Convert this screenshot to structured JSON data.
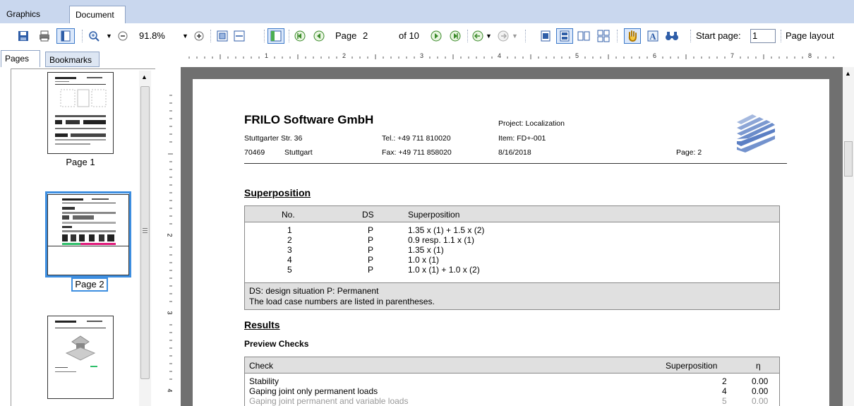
{
  "tabs": {
    "graphics": "Graphics",
    "document": "Document"
  },
  "toolbar": {
    "zoom": "91.8%",
    "page_label": "Page",
    "page_value": "2",
    "of_label": "of 10",
    "start_page_label": "Start page:",
    "start_page_value": "1",
    "page_layout_label": "Page layout"
  },
  "left_panel": {
    "tabs": {
      "pages": "Pages",
      "bookmarks": "Bookmarks"
    },
    "thumbs": [
      {
        "label": "Page 1"
      },
      {
        "label": "Page 2"
      }
    ]
  },
  "ruler": {
    "marks": [
      "1",
      "2",
      "3",
      "4",
      "5",
      "6",
      "7",
      "8"
    ],
    "vmarks": [
      "2",
      "3",
      "4"
    ]
  },
  "document": {
    "company": "FRILO Software GmbH",
    "street": "Stuttgarter Str. 36",
    "zip": "70469",
    "city": "Stuttgart",
    "tel": "Tel.: +49 711 810020",
    "fax": "Fax: +49 711 858020",
    "project": "Project: Localization",
    "item": "Item: FD+-001",
    "date": "8/16/2018",
    "page": "Page: 2",
    "superposition_title": "Superposition",
    "sp_headers": {
      "no": "No.",
      "ds": "DS",
      "sp": "Superposition"
    },
    "sp_rows": [
      {
        "no": "1",
        "ds": "P",
        "sp": "1.35 x (1) + 1.5 x (2)"
      },
      {
        "no": "2",
        "ds": "P",
        "sp": "0.9 resp. 1.1 x (1)"
      },
      {
        "no": "3",
        "ds": "P",
        "sp": "1.35 x (1)"
      },
      {
        "no": "4",
        "ds": "P",
        "sp": "1.0 x (1)"
      },
      {
        "no": "5",
        "ds": "P",
        "sp": "1.0 x (1) + 1.0 x (2)"
      }
    ],
    "sp_note1": "DS: design situation P: Permanent",
    "sp_note2": "The load case numbers are listed in parentheses.",
    "results_title": "Results",
    "preview_title": "Preview Checks",
    "check_headers": {
      "check": "Check",
      "sp": "Superposition",
      "eta": "η"
    },
    "check_rows": [
      {
        "check": "Stability",
        "sp": "2",
        "eta": "0.00"
      },
      {
        "check": "Gaping joint only permanent loads",
        "sp": "4",
        "eta": "0.00"
      },
      {
        "check": "Gaping joint permanent and variable loads",
        "sp": "5",
        "eta": "0.00"
      }
    ]
  },
  "colors": {
    "accent": "#3d8ee0",
    "tabstrip": "#c9d7ee"
  }
}
